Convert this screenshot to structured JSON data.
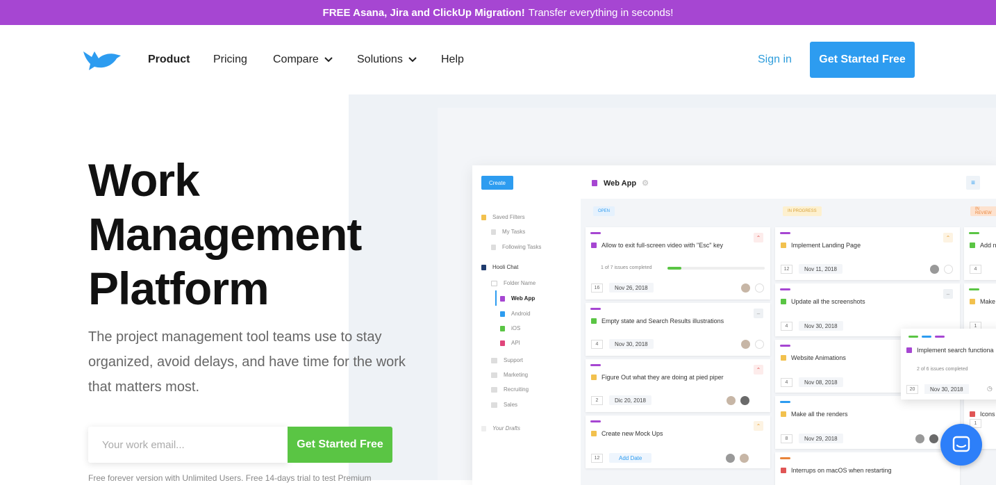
{
  "banner": {
    "bold": "FREE Asana, Jira and ClickUp Migration!",
    "text": "Transfer everything in seconds!"
  },
  "nav": {
    "items": [
      "Product",
      "Pricing",
      "Compare",
      "Solutions",
      "Help"
    ],
    "sign_in": "Sign in",
    "cta": "Get Started Free"
  },
  "hero": {
    "title_lines": [
      "Work",
      "Management",
      "Platform"
    ],
    "subtitle": "The project management tool teams use to stay organized, avoid delays, and have time for the work that matters most.",
    "email_placeholder": "Your work email...",
    "cta": "Get Started Free",
    "fine_print": "Free forever version with Unlimited Users. Free 14-days trial to test Premium"
  },
  "app": {
    "create": "Create",
    "title": "Web App",
    "sidebar": {
      "saved_filters": "Saved Filters",
      "my_tasks": "My Tasks",
      "following": "Following Tasks",
      "workspace": "Hooli Chat",
      "folder": "Folder Name",
      "web_app": "Web App",
      "android": "Android",
      "ios": "iOS",
      "api": "API",
      "support": "Support",
      "marketing": "Marketing",
      "recruiting": "Recruiting",
      "sales": "Sales",
      "drafts": "Your Drafts"
    },
    "columns": [
      {
        "tag": "OPEN"
      },
      {
        "tag": "IN PROGRESS"
      },
      {
        "tag": "IN REVIEW"
      }
    ],
    "cards_open": [
      {
        "title": "Allow to exit full-screen video with \"Esc\" key",
        "progress": "1 of 7 issues completed",
        "num": "16",
        "date": "Nov 26, 2018"
      },
      {
        "title": "Empty state and Search Results illustrations",
        "num": "4",
        "date": "Nov 30, 2018"
      },
      {
        "title": "Figure Out what they are doing at pied piper",
        "num": "2",
        "date": "Dic 20, 2018"
      },
      {
        "title": "Create new Mock Ups",
        "num": "12",
        "date": "Add Date"
      }
    ],
    "cards_progress": [
      {
        "title": "Implement Landing Page",
        "num": "12",
        "date": "Nov 11, 2018"
      },
      {
        "title": "Update all the screenshots",
        "num": "4",
        "date": "Nov 30, 2018"
      },
      {
        "title": "Website Animations",
        "num": "4",
        "date": "Nov 08, 2018"
      },
      {
        "title": "Make all the renders",
        "num": "8",
        "date": "Nov 29, 2018"
      },
      {
        "title": "Interrups on macOS when restarting"
      }
    ],
    "cards_review": [
      {
        "title": "Add n",
        "num": "4"
      },
      {
        "title": "Make",
        "num": "1"
      },
      {
        "title": "Icons",
        "num": "1"
      }
    ],
    "float_card": {
      "title": "Implement search functiona",
      "progress": "2 of 6 issues completed",
      "num": "20",
      "date": "Nov 30, 2018"
    }
  },
  "colors": {
    "banner": "#a646d2",
    "primary": "#2d9cf0",
    "green": "#5ac544"
  }
}
